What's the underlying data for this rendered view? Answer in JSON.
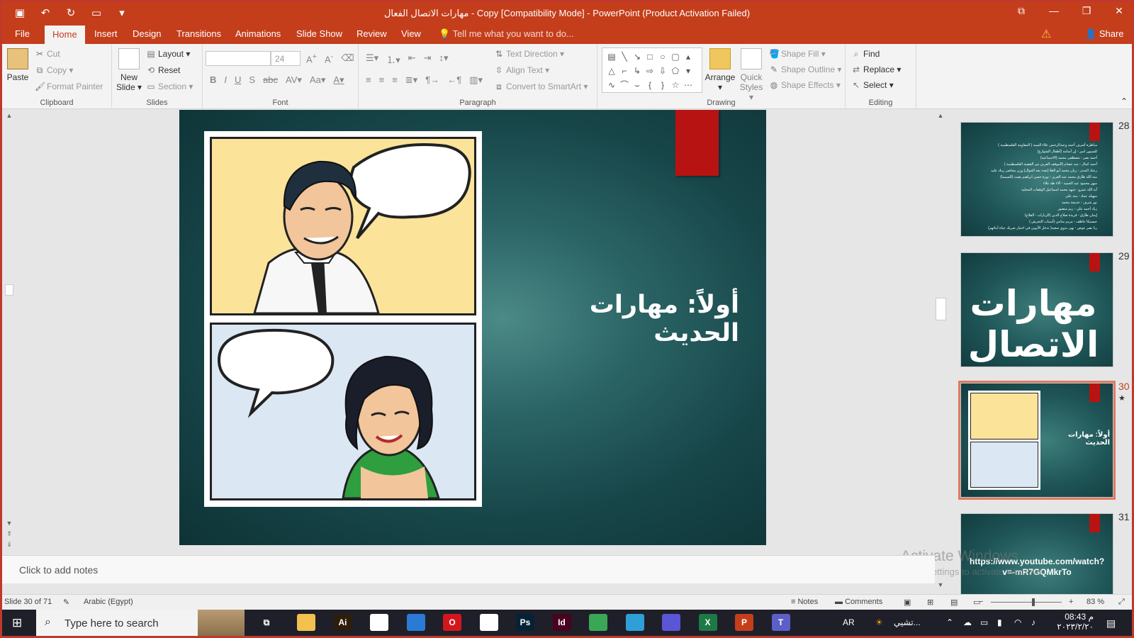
{
  "window": {
    "title": "مهارات الاتصال الفعال - Copy [Compatibility Mode] - PowerPoint (Product Activation Failed)"
  },
  "tabs": [
    "File",
    "Home",
    "Insert",
    "Design",
    "Transitions",
    "Animations",
    "Slide Show",
    "Review",
    "View"
  ],
  "active_tab": "Home",
  "tell_me": "Tell me what you want to do...",
  "share_label": "Share",
  "ribbon": {
    "clipboard": {
      "paste": "Paste",
      "cut": "Cut",
      "copy": "Copy",
      "format_painter": "Format Painter",
      "label": "Clipboard"
    },
    "slides": {
      "new_slide_line1": "New",
      "new_slide_line2": "Slide",
      "layout": "Layout",
      "reset": "Reset",
      "section": "Section",
      "label": "Slides"
    },
    "font": {
      "font_name": "",
      "font_size": "24",
      "label": "Font"
    },
    "paragraph": {
      "text_direction": "Text Direction",
      "align_text": "Align Text",
      "convert_smartart": "Convert to SmartArt",
      "label": "Paragraph"
    },
    "drawing": {
      "arrange": "Arrange",
      "quick_styles_line1": "Quick",
      "quick_styles_line2": "Styles",
      "shape_fill": "Shape Fill",
      "shape_outline": "Shape Outline",
      "shape_effects": "Shape Effects",
      "label": "Drawing"
    },
    "editing": {
      "find": "Find",
      "replace": "Replace",
      "select": "Select",
      "label": "Editing"
    }
  },
  "slide": {
    "heading": "أولاً: مهارات الحديث"
  },
  "thumbnails": [
    {
      "num": "28",
      "lines": [
        "مناظرة أشرف أحمد وعبدالرحمن علاء السيد ( المقاومة الفلسطينية )",
        "للسيون امير - إن أسامة (أطفال الشوارع)",
        "أحمد نصر - مصطفى محمد (الاجتماعية)",
        "أحمد كمال - منه عصام (الموقف العربي من القضية الفلسطينية )",
        "رعناد المنذر - ريان محمد أبو العلا (تعدد بعد الجوال) وزن محاضر ريناد عليد",
        "منة الله طارق محمد عبد العزيز - نورة حسن ابراهيم يغيث (السينما)",
        "سهر محمود عبد الحميد - الاء طه علاء",
        "آية الله عمرو - شهد محمد اسماعيل الوقفات المحلية",
        "سهيله عماد - منة علي",
        "نور شرف - خديجة محمد",
        "زياد أحمد علي - ريم منصور",
        "إيمان طارق - فريدة صلاح الدين (الزيارات - الفلاح)",
        "جيسيكا عاطف - مريم سامي (أسباب التحرش )",
        "رنا نصر عوض - نهى بدوي سعيد( تدخل الأبوين في اختيار شريك حياة أبنائهم)"
      ]
    },
    {
      "num": "29",
      "title": "مهارات الاتصال"
    },
    {
      "num": "30",
      "heading": "أولاً: مهارات الحديث",
      "star": "★"
    },
    {
      "num": "31",
      "link": "https://www.youtube.com/watch?v=-mR7GQMkrTo"
    }
  ],
  "watermark": {
    "line1": "Activate Windows",
    "line2": "Go to Settings to activate Windows."
  },
  "notes_placeholder": "Click to add notes",
  "status": {
    "slide_counter": "Slide 30 of 71",
    "language": "Arabic (Egypt)",
    "notes": "Notes",
    "comments": "Comments",
    "zoom": "83 %"
  },
  "taskbar": {
    "search_placeholder": "Type here to search",
    "apps": [
      {
        "name": "file-explorer",
        "glyph": "",
        "bg": "#f2c14e"
      },
      {
        "name": "illustrator",
        "glyph": "Ai",
        "bg": "#2d1d0c"
      },
      {
        "name": "store",
        "glyph": "",
        "bg": "#ffffff"
      },
      {
        "name": "mail",
        "glyph": "",
        "bg": "#2a7ad6"
      },
      {
        "name": "opera",
        "glyph": "O",
        "bg": "#d2161d"
      },
      {
        "name": "notepad",
        "glyph": "",
        "bg": "#ffffff"
      },
      {
        "name": "photoshop",
        "glyph": "Ps",
        "bg": "#062336"
      },
      {
        "name": "indesign",
        "glyph": "Id",
        "bg": "#49021f"
      },
      {
        "name": "chrome",
        "glyph": "",
        "bg": "#3aa757"
      },
      {
        "name": "edge",
        "glyph": "",
        "bg": "#2f9fd8"
      },
      {
        "name": "media",
        "glyph": "",
        "bg": "#5a56d6"
      },
      {
        "name": "excel",
        "glyph": "X",
        "bg": "#1d7a45"
      },
      {
        "name": "powerpoint",
        "glyph": "P",
        "bg": "#c43e1c"
      },
      {
        "name": "teams",
        "glyph": "T",
        "bg": "#5b5fc7"
      }
    ],
    "lang": "AR",
    "weather_text": "تشيي...",
    "time": "08:43 م",
    "date": "٢٠٢٣/٢/٢٠"
  }
}
